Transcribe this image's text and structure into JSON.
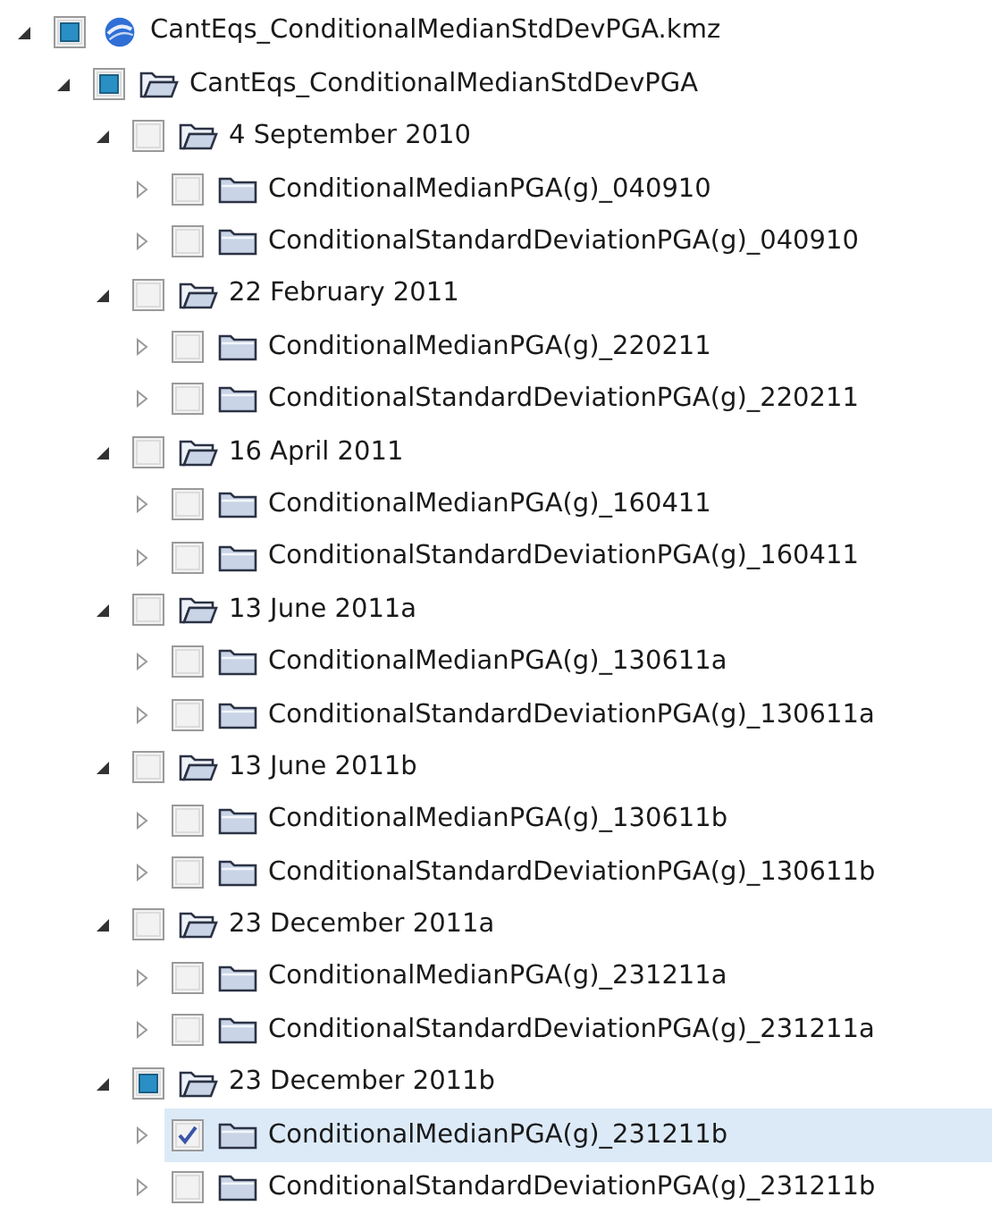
{
  "tree": [
    {
      "label": "CantEqs_ConditionalMedianStdDevPGA.kmz",
      "kind": "globe",
      "expanded": true,
      "checked": false,
      "partial": true,
      "children": [
        {
          "label": "CantEqs_ConditionalMedianStdDevPGA",
          "kind": "folder",
          "expanded": true,
          "checked": false,
          "partial": true,
          "children": [
            {
              "label": "4 September 2010",
              "kind": "folder",
              "expanded": true,
              "checked": false,
              "partial": false,
              "children": [
                {
                  "label": "ConditionalMedianPGA(g)_040910",
                  "kind": "folder",
                  "expanded": false,
                  "checked": false,
                  "partial": false,
                  "selected": false
                },
                {
                  "label": "ConditionalStandardDeviationPGA(g)_040910",
                  "kind": "folder",
                  "expanded": false,
                  "checked": false,
                  "partial": false,
                  "selected": false
                }
              ]
            },
            {
              "label": "22 February 2011",
              "kind": "folder",
              "expanded": true,
              "checked": false,
              "partial": false,
              "children": [
                {
                  "label": "ConditionalMedianPGA(g)_220211",
                  "kind": "folder",
                  "expanded": false,
                  "checked": false,
                  "partial": false,
                  "selected": false
                },
                {
                  "label": "ConditionalStandardDeviationPGA(g)_220211",
                  "kind": "folder",
                  "expanded": false,
                  "checked": false,
                  "partial": false,
                  "selected": false
                }
              ]
            },
            {
              "label": "16 April 2011",
              "kind": "folder",
              "expanded": true,
              "checked": false,
              "partial": false,
              "children": [
                {
                  "label": "ConditionalMedianPGA(g)_160411",
                  "kind": "folder",
                  "expanded": false,
                  "checked": false,
                  "partial": false,
                  "selected": false
                },
                {
                  "label": "ConditionalStandardDeviationPGA(g)_160411",
                  "kind": "folder",
                  "expanded": false,
                  "checked": false,
                  "partial": false,
                  "selected": false
                }
              ]
            },
            {
              "label": "13 June 2011a",
              "kind": "folder",
              "expanded": true,
              "checked": false,
              "partial": false,
              "children": [
                {
                  "label": "ConditionalMedianPGA(g)_130611a",
                  "kind": "folder",
                  "expanded": false,
                  "checked": false,
                  "partial": false,
                  "selected": false
                },
                {
                  "label": "ConditionalStandardDeviationPGA(g)_130611a",
                  "kind": "folder",
                  "expanded": false,
                  "checked": false,
                  "partial": false,
                  "selected": false
                }
              ]
            },
            {
              "label": "13 June 2011b",
              "kind": "folder",
              "expanded": true,
              "checked": false,
              "partial": false,
              "children": [
                {
                  "label": "ConditionalMedianPGA(g)_130611b",
                  "kind": "folder",
                  "expanded": false,
                  "checked": false,
                  "partial": false,
                  "selected": false
                },
                {
                  "label": "ConditionalStandardDeviationPGA(g)_130611b",
                  "kind": "folder",
                  "expanded": false,
                  "checked": false,
                  "partial": false,
                  "selected": false
                }
              ]
            },
            {
              "label": "23 December 2011a",
              "kind": "folder",
              "expanded": true,
              "checked": false,
              "partial": false,
              "children": [
                {
                  "label": "ConditionalMedianPGA(g)_231211a",
                  "kind": "folder",
                  "expanded": false,
                  "checked": false,
                  "partial": false,
                  "selected": false
                },
                {
                  "label": "ConditionalStandardDeviationPGA(g)_231211a",
                  "kind": "folder",
                  "expanded": false,
                  "checked": false,
                  "partial": false,
                  "selected": false
                }
              ]
            },
            {
              "label": "23 December 2011b",
              "kind": "folder",
              "expanded": true,
              "checked": false,
              "partial": true,
              "children": [
                {
                  "label": "ConditionalMedianPGA(g)_231211b",
                  "kind": "folder",
                  "expanded": false,
                  "checked": true,
                  "partial": false,
                  "selected": true
                },
                {
                  "label": "ConditionalStandardDeviationPGA(g)_231211b",
                  "kind": "folder",
                  "expanded": false,
                  "checked": false,
                  "partial": false,
                  "selected": false
                }
              ]
            }
          ]
        }
      ]
    }
  ]
}
